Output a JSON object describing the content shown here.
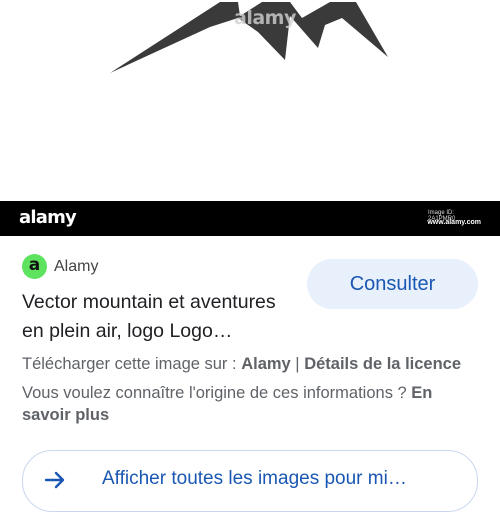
{
  "image": {
    "subject_icon": "mountain-logo",
    "watermark_text": "alamy"
  },
  "watermark_bar": {
    "logo_text": "alamy",
    "image_id": "Image ID: 2A1PMR0",
    "site": "www.alamy.com"
  },
  "source": {
    "favicon_letter": "a",
    "name": "Alamy"
  },
  "consult_button": {
    "label": "Consulter"
  },
  "result": {
    "title": "Vector mountain et aventures en plein air, logo Logo…"
  },
  "download": {
    "prefix": "Télécharger cette image sur : ",
    "site": "Alamy",
    "separator": " | ",
    "license_link": "Détails de la licence"
  },
  "origin": {
    "question": "Vous voulez connaître l'origine de ces informations ? ",
    "link": "En savoir plus"
  },
  "all_images": {
    "label": "Afficher toutes les images pour mi…",
    "icon": "arrow-right-icon"
  },
  "colors": {
    "accent": "#1a57b2",
    "button_bg": "#e8f0fb",
    "favicon_green": "#5ee35e",
    "bar_bg": "#000000"
  }
}
